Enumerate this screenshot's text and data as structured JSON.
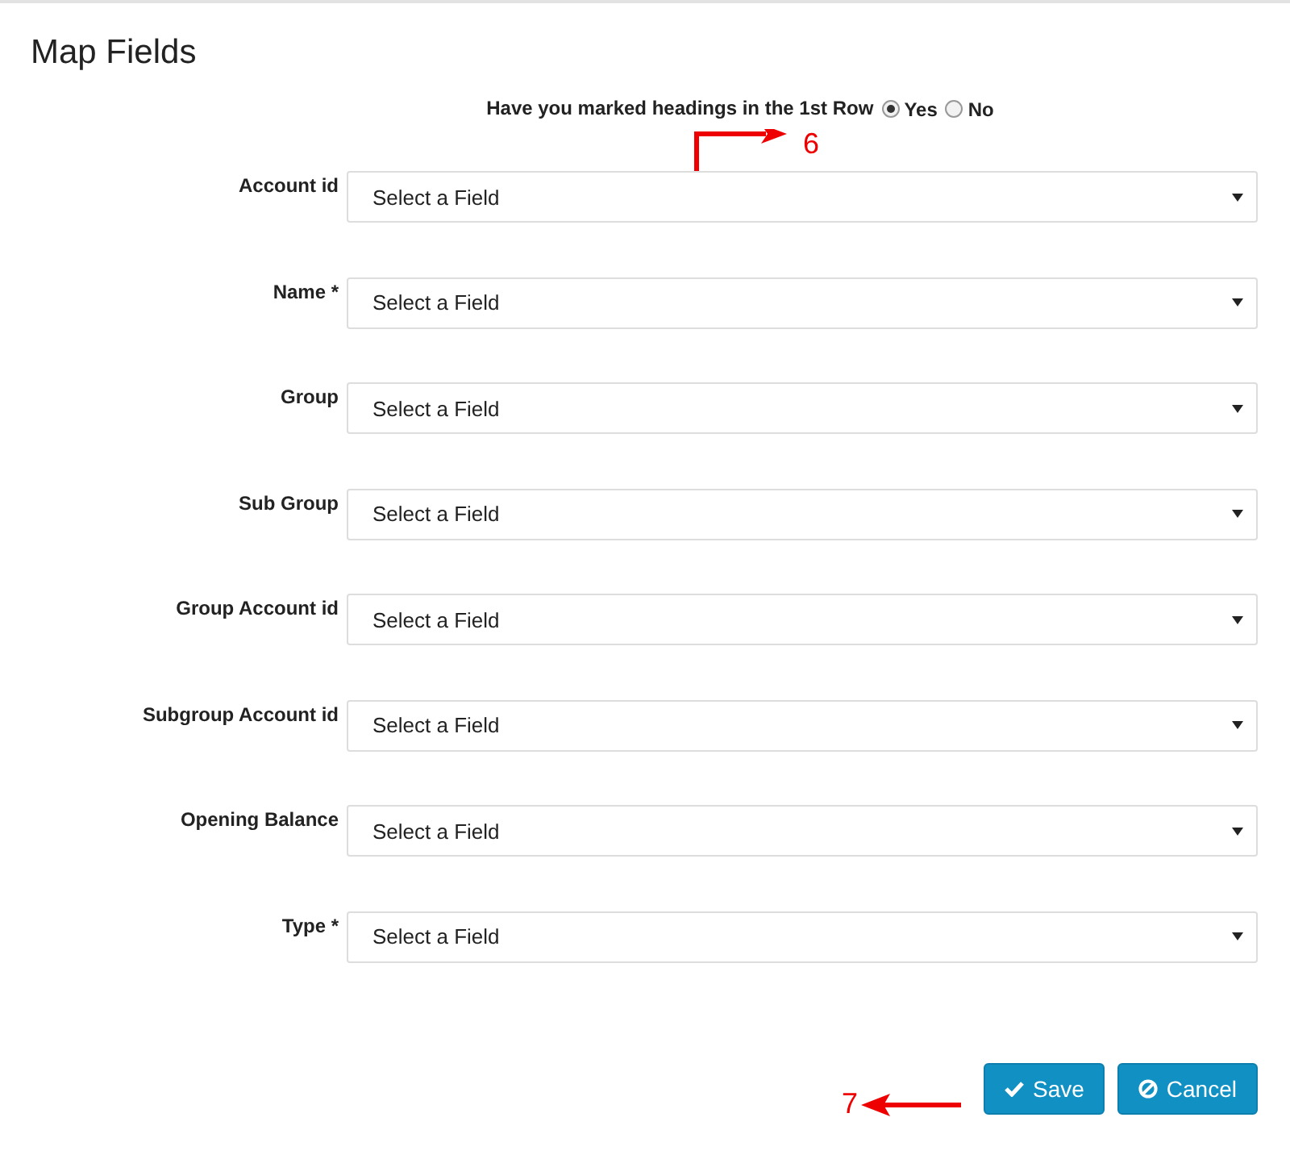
{
  "title": "Map Fields",
  "headings_question": {
    "label": "Have you marked headings in the 1st Row",
    "options": [
      {
        "label": "Yes",
        "selected": true
      },
      {
        "label": "No",
        "selected": false
      }
    ]
  },
  "fields": [
    {
      "label": "Account id",
      "value": "Select a Field"
    },
    {
      "label": "Name *",
      "value": "Select a Field"
    },
    {
      "label": "Group",
      "value": "Select a Field"
    },
    {
      "label": "Sub Group",
      "value": "Select a Field"
    },
    {
      "label": "Group Account id",
      "value": "Select a Field"
    },
    {
      "label": "Subgroup Account id",
      "value": "Select a Field"
    },
    {
      "label": "Opening Balance",
      "value": "Select a Field"
    },
    {
      "label": "Type *",
      "value": "Select a Field"
    }
  ],
  "buttons": [
    {
      "kind": "save",
      "label": "Save"
    },
    {
      "kind": "cancel",
      "label": "Cancel"
    }
  ],
  "callouts": [
    {
      "kind": "elbow",
      "number": "6"
    },
    {
      "kind": "left",
      "number": "7"
    }
  ]
}
